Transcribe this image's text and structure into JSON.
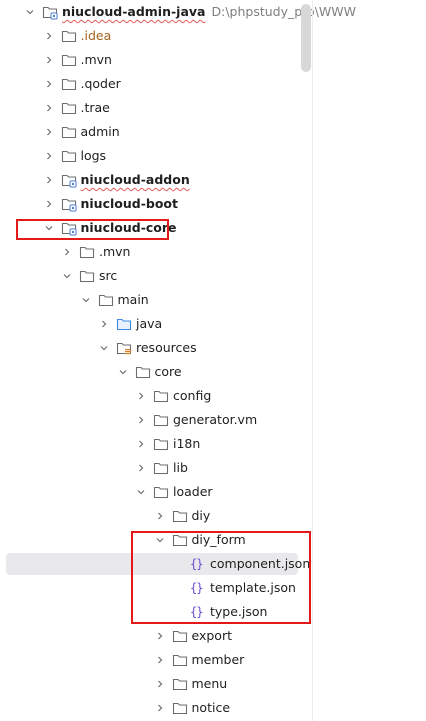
{
  "project": {
    "name": "niucloud-admin-java",
    "path": "D:\\phpstudy_pro\\WWW"
  },
  "tree": [
    {
      "label": "niucloud-admin-java",
      "type": "module",
      "depth": 0,
      "chevron": "down",
      "bold": true,
      "squiggle": true
    },
    {
      "label": ".idea",
      "type": "folder",
      "depth": 1,
      "chevron": "right",
      "color": "orange"
    },
    {
      "label": ".mvn",
      "type": "folder",
      "depth": 1,
      "chevron": "right"
    },
    {
      "label": ".qoder",
      "type": "folder",
      "depth": 1,
      "chevron": "right"
    },
    {
      "label": ".trae",
      "type": "folder",
      "depth": 1,
      "chevron": "right"
    },
    {
      "label": "admin",
      "type": "folder",
      "depth": 1,
      "chevron": "right"
    },
    {
      "label": "logs",
      "type": "folder",
      "depth": 1,
      "chevron": "right"
    },
    {
      "label": "niucloud-addon",
      "type": "module",
      "depth": 1,
      "chevron": "right",
      "bold": true,
      "squiggle": true
    },
    {
      "label": "niucloud-boot",
      "type": "module",
      "depth": 1,
      "chevron": "right",
      "bold": true
    },
    {
      "label": "niucloud-core",
      "type": "module",
      "depth": 1,
      "chevron": "down",
      "bold": true
    },
    {
      "label": ".mvn",
      "type": "folder",
      "depth": 2,
      "chevron": "right"
    },
    {
      "label": "src",
      "type": "folder",
      "depth": 2,
      "chevron": "down"
    },
    {
      "label": "main",
      "type": "folder",
      "depth": 3,
      "chevron": "down"
    },
    {
      "label": "java",
      "type": "source-folder",
      "depth": 4,
      "chevron": "right"
    },
    {
      "label": "resources",
      "type": "resources-folder",
      "depth": 4,
      "chevron": "down"
    },
    {
      "label": "core",
      "type": "folder",
      "depth": 5,
      "chevron": "down"
    },
    {
      "label": "config",
      "type": "folder",
      "depth": 6,
      "chevron": "right"
    },
    {
      "label": "generator.vm",
      "type": "folder",
      "depth": 6,
      "chevron": "right"
    },
    {
      "label": "i18n",
      "type": "folder",
      "depth": 6,
      "chevron": "right"
    },
    {
      "label": "lib",
      "type": "folder",
      "depth": 6,
      "chevron": "right"
    },
    {
      "label": "loader",
      "type": "folder",
      "depth": 6,
      "chevron": "down"
    },
    {
      "label": "diy",
      "type": "folder",
      "depth": 7,
      "chevron": "right"
    },
    {
      "label": "diy_form",
      "type": "folder",
      "depth": 7,
      "chevron": "down"
    },
    {
      "label": "component.json",
      "type": "json",
      "depth": 8,
      "selected": true
    },
    {
      "label": "template.json",
      "type": "json",
      "depth": 8
    },
    {
      "label": "type.json",
      "type": "json",
      "depth": 8
    },
    {
      "label": "export",
      "type": "folder",
      "depth": 7,
      "chevron": "right"
    },
    {
      "label": "member",
      "type": "folder",
      "depth": 7,
      "chevron": "right"
    },
    {
      "label": "menu",
      "type": "folder",
      "depth": 7,
      "chevron": "right"
    },
    {
      "label": "notice",
      "type": "folder",
      "depth": 7,
      "chevron": "right"
    }
  ],
  "json_icon_glyph": "{}",
  "colors": {
    "folder_stroke": "#6e6e6e",
    "source_folder": "#3d8ae8",
    "resources_bars": "#d9822b",
    "module_badge": "#4a7bd6",
    "highlight": "#e41a1a",
    "selection": "#e9e9eb"
  }
}
